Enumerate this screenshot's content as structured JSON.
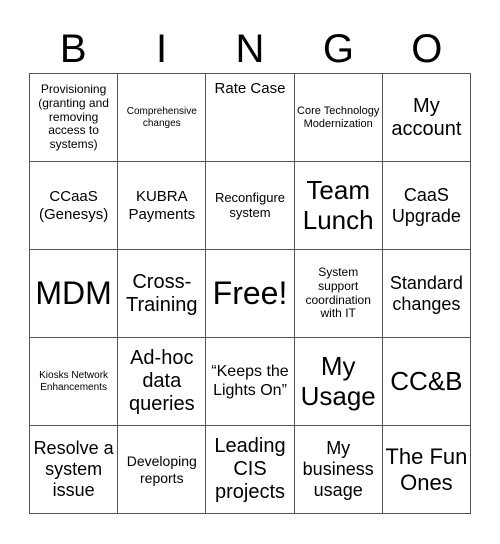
{
  "header": {
    "letters": [
      "B",
      "I",
      "N",
      "G",
      "O"
    ]
  },
  "cells": [
    [
      "Provisioning (granting and removing access to systems)",
      "Comprehensive changes",
      "Rate Case",
      "Core Technology Modernization",
      "My account"
    ],
    [
      "CCaaS (Genesys)",
      "KUBRA Payments",
      "Reconfigure system",
      "Team Lunch",
      "CaaS Upgrade"
    ],
    [
      "MDM",
      "Cross-Training",
      "Free!",
      "System support coordination with IT",
      "Standard changes"
    ],
    [
      "Kiosks Network Enhancements",
      "Ad-hoc data queries",
      "“Keeps the Lights On”",
      "My Usage",
      "CC&B"
    ],
    [
      "Resolve a system issue",
      "Developing reports",
      "Leading CIS projects",
      "My business usage",
      "The Fun Ones"
    ]
  ]
}
